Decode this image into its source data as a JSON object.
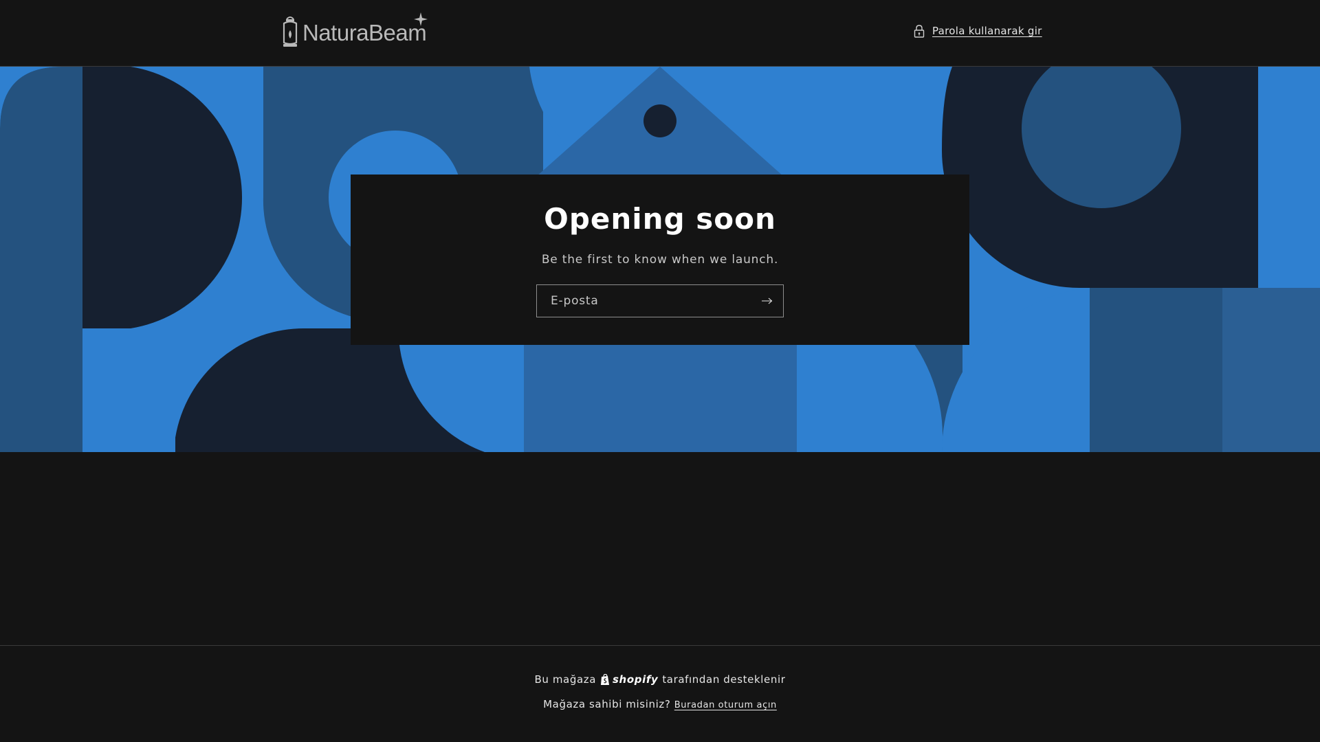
{
  "header": {
    "logo_text": "NaturaBeam",
    "password_link_label": "Parola kullanarak gir"
  },
  "hero": {
    "title": "Opening soon",
    "subtitle": "Be the first to know when we launch.",
    "email": {
      "placeholder": "E-posta",
      "value": ""
    }
  },
  "footer": {
    "powered_prefix": "Bu mağaza",
    "powered_brand": "shopify",
    "powered_suffix": "tarafından desteklenir",
    "owner_question": "Mağaza sahibi misiniz?",
    "owner_login_link": "Buradan oturum açın"
  },
  "colors": {
    "background": "#141414",
    "hero_blue_light": "#2f80d0",
    "hero_blue_mid": "#2b67a6",
    "hero_blue_steel": "#24527f",
    "hero_navy": "#162030"
  }
}
